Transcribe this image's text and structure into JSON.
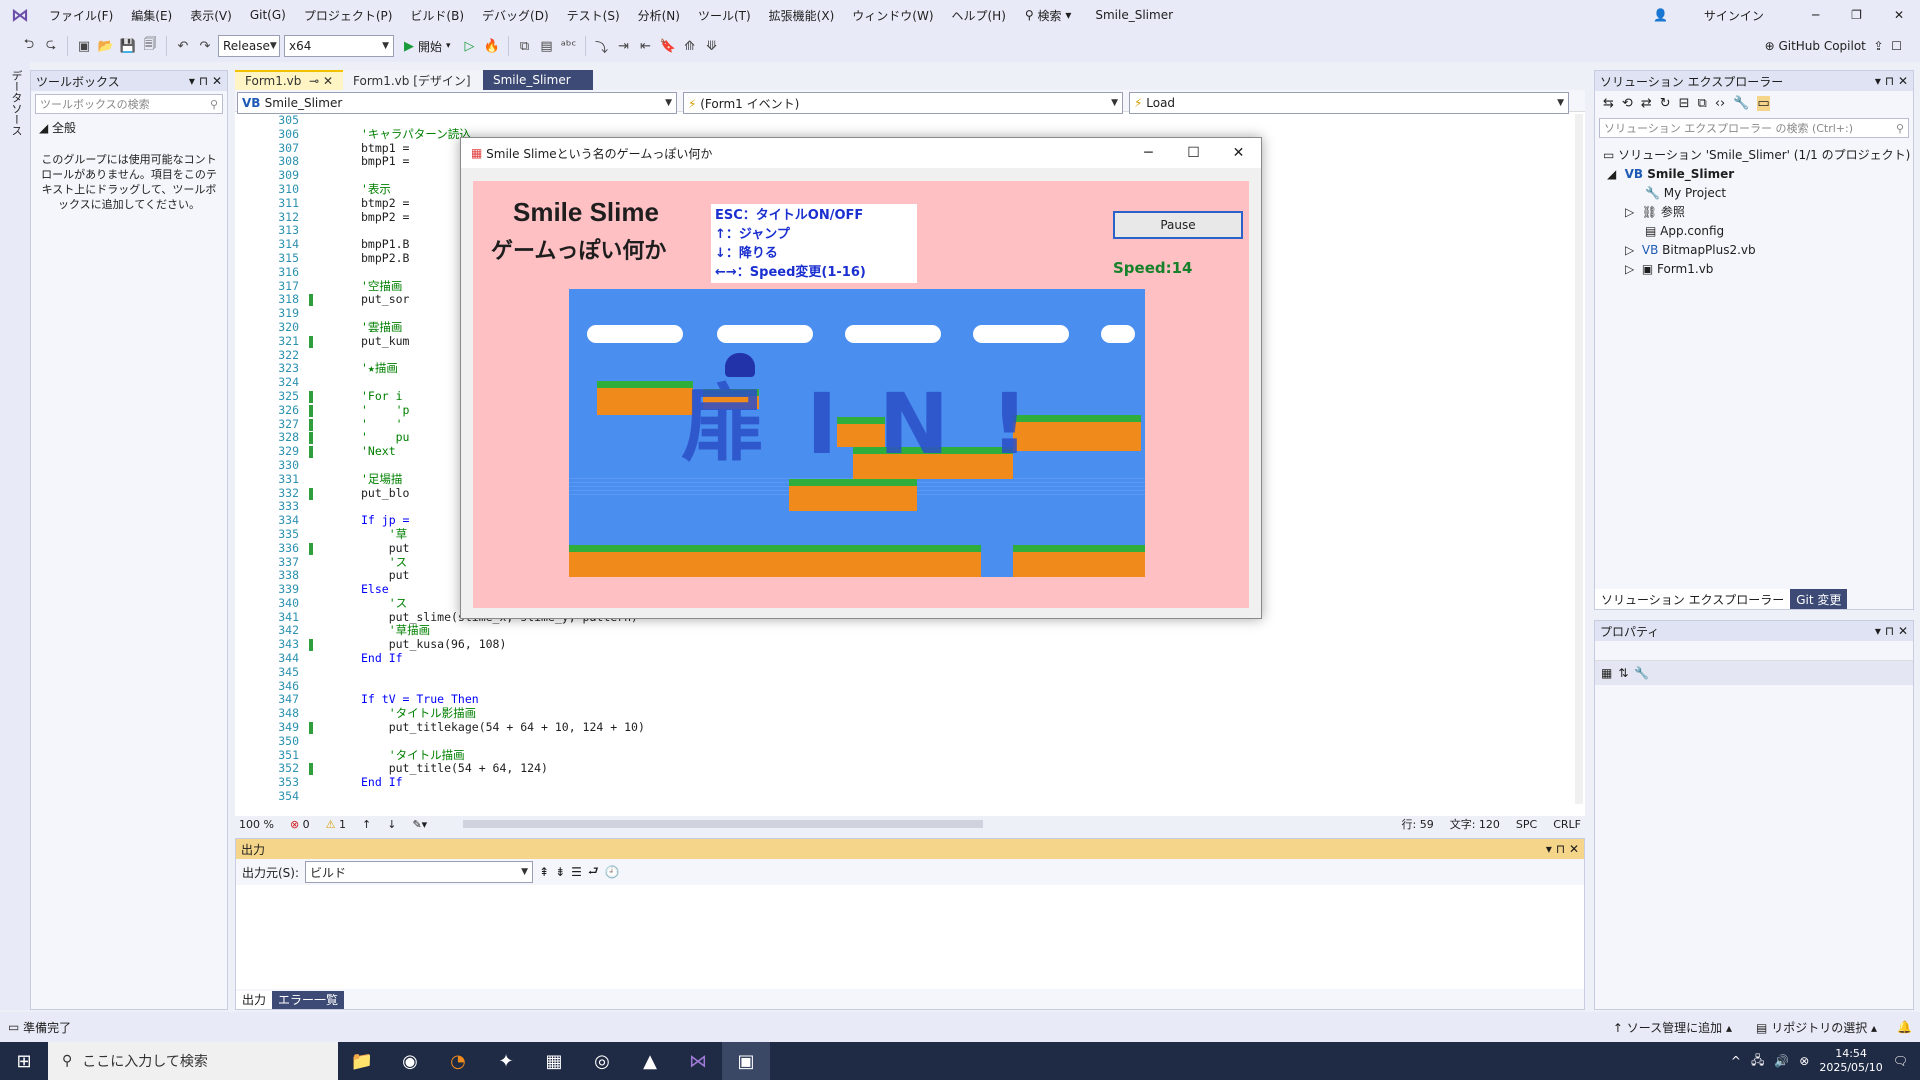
{
  "menubar": {
    "items": [
      "ファイル(F)",
      "編集(E)",
      "表示(V)",
      "Git(G)",
      "プロジェクト(P)",
      "ビルド(B)",
      "デバッグ(D)",
      "テスト(S)",
      "分析(N)",
      "ツール(T)",
      "拡張機能(X)",
      "ウィンドウ(W)",
      "ヘルプ(H)"
    ],
    "search": "検索",
    "solution_title": "Smile_Slimer",
    "signin": "サインイン"
  },
  "toolbar": {
    "config": "Release",
    "platform": "x64",
    "start": "開始",
    "copilot": "GitHub Copilot"
  },
  "leftstrip": {
    "label": "データソース"
  },
  "toolbox": {
    "title": "ツールボックス",
    "search_placeholder": "ツールボックスの検索",
    "group": "全般",
    "empty_text": "このグループには使用可能なコントロールがありません。項目をこのテキスト上にドラッグして、ツールボックスに追加してください。"
  },
  "editor": {
    "tabs": [
      "Form1.vb",
      "Form1.vb [デザイン]",
      "Smile_Slimer"
    ],
    "nav": [
      "Smile_Slimer",
      "(Form1 イベント)",
      "Load"
    ],
    "lines": [
      {
        "n": "305",
        "t": "",
        "c": ""
      },
      {
        "n": "306",
        "t": "'キャラパターン読込",
        "c": "cm"
      },
      {
        "n": "307",
        "t": "btmp1 =",
        "c": ""
      },
      {
        "n": "308",
        "t": "bmpP1 =",
        "c": ""
      },
      {
        "n": "309",
        "t": "",
        "c": ""
      },
      {
        "n": "310",
        "t": "'表示",
        "c": "cm"
      },
      {
        "n": "311",
        "t": "btmp2 =",
        "c": ""
      },
      {
        "n": "312",
        "t": "bmpP2 =",
        "c": ""
      },
      {
        "n": "313",
        "t": "",
        "c": ""
      },
      {
        "n": "314",
        "t": "bmpP1.B",
        "c": ""
      },
      {
        "n": "315",
        "t": "bmpP2.B",
        "c": ""
      },
      {
        "n": "316",
        "t": "",
        "c": ""
      },
      {
        "n": "317",
        "t": "'空描画",
        "c": "cm"
      },
      {
        "n": "318",
        "t": "put_sor",
        "c": ""
      },
      {
        "n": "319",
        "t": "",
        "c": ""
      },
      {
        "n": "320",
        "t": "'雲描画",
        "c": "cm"
      },
      {
        "n": "321",
        "t": "put_kum",
        "c": ""
      },
      {
        "n": "322",
        "t": "",
        "c": ""
      },
      {
        "n": "323",
        "t": "'★描画",
        "c": "cm"
      },
      {
        "n": "324",
        "t": "",
        "c": ""
      },
      {
        "n": "325",
        "t": "'For i",
        "c": "cm"
      },
      {
        "n": "326",
        "t": "'    'p",
        "c": "cm"
      },
      {
        "n": "327",
        "t": "'    '",
        "c": "cm"
      },
      {
        "n": "328",
        "t": "'    pu",
        "c": "cm"
      },
      {
        "n": "329",
        "t": "'Next",
        "c": "cm"
      },
      {
        "n": "330",
        "t": "",
        "c": ""
      },
      {
        "n": "331",
        "t": "'足場描",
        "c": "cm"
      },
      {
        "n": "332",
        "t": "put_blo",
        "c": ""
      },
      {
        "n": "333",
        "t": "",
        "c": ""
      },
      {
        "n": "334",
        "t": "If jp =",
        "c": "kw"
      },
      {
        "n": "335",
        "t": "    '草",
        "c": "cm"
      },
      {
        "n": "336",
        "t": "    put",
        "c": ""
      },
      {
        "n": "337",
        "t": "    'ス",
        "c": "cm"
      },
      {
        "n": "338",
        "t": "    put",
        "c": ""
      },
      {
        "n": "339",
        "t": "Else",
        "c": "kw"
      },
      {
        "n": "340",
        "t": "    'ス",
        "c": "cm"
      },
      {
        "n": "341",
        "t": "    put_slime(slime_x, slime_y, pattern)",
        "c": ""
      },
      {
        "n": "342",
        "t": "    '草描画",
        "c": "cm"
      },
      {
        "n": "343",
        "t": "    put_kusa(96, 108)",
        "c": ""
      },
      {
        "n": "344",
        "t": "End If",
        "c": "kw"
      },
      {
        "n": "345",
        "t": "",
        "c": ""
      },
      {
        "n": "346",
        "t": "",
        "c": ""
      },
      {
        "n": "347",
        "t": "If tV = True Then",
        "c": "kw"
      },
      {
        "n": "348",
        "t": "    'タイトル影描画",
        "c": "cm"
      },
      {
        "n": "349",
        "t": "    put_titlekage(54 + 64 + 10, 124 + 10)",
        "c": ""
      },
      {
        "n": "350",
        "t": "",
        "c": ""
      },
      {
        "n": "351",
        "t": "    'タイトル描画",
        "c": "cm"
      },
      {
        "n": "352",
        "t": "    put_title(54 + 64, 124)",
        "c": ""
      },
      {
        "n": "353",
        "t": "End If",
        "c": "kw"
      },
      {
        "n": "354",
        "t": "",
        "c": ""
      }
    ],
    "changed_lines": [
      "318",
      "321",
      "325",
      "326",
      "327",
      "328",
      "329",
      "332",
      "336",
      "343",
      "349",
      "352"
    ],
    "status": {
      "zoom": "100 %",
      "errors": "0",
      "warnings": "1",
      "line": "行: 59",
      "col": "文字: 120",
      "spc": "SPC",
      "crlf": "CRLF"
    }
  },
  "game": {
    "window_title": "Smile Slimeという名のゲームっぽい何か",
    "title1": "Smile Slime",
    "title2": "ゲームっぽい何か",
    "help": [
      "ESC：タイトルON/OFF",
      "↑：ジャンプ",
      "↓：降りる",
      "←→：Speed変更(1-16)"
    ],
    "pause": "Pause",
    "speed": "Speed:14",
    "overlay": "扉 I N !"
  },
  "solution": {
    "title": "ソリューション エクスプローラー",
    "search_placeholder": "ソリューション エクスプローラー の検索 (Ctrl+:)",
    "items": [
      "ソリューション 'Smile_Slimer' (1/1 のプロジェクト)",
      "Smile_Slimer",
      "My Project",
      "参照",
      "App.config",
      "BitmapPlus2.vb",
      "Form1.vb"
    ],
    "tabs": [
      "ソリューション エクスプローラー",
      "Git 変更"
    ]
  },
  "properties": {
    "title": "プロパティ"
  },
  "output": {
    "title": "出力",
    "source_label": "出力元(S):",
    "source_value": "ビルド",
    "tabs": [
      "出力",
      "エラー一覧"
    ]
  },
  "status": {
    "ready": "準備完了",
    "source_control": "ソース管理に追加",
    "repo": "リポジトリの選択"
  },
  "taskbar": {
    "search": "ここに入力して検索",
    "time": "14:54",
    "date": "2025/05/10"
  }
}
